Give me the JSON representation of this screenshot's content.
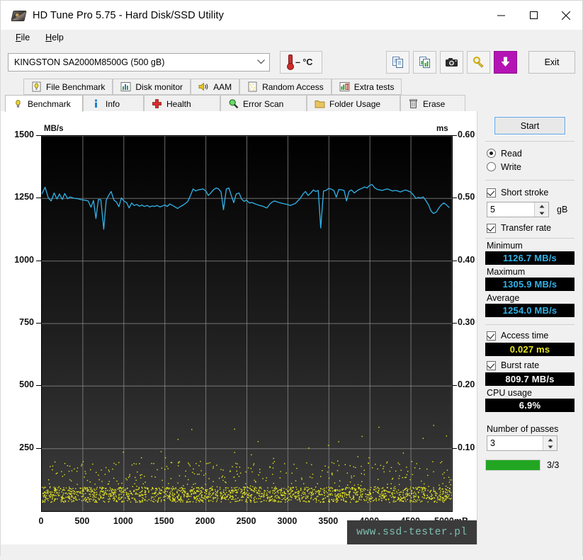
{
  "window": {
    "title": "HD Tune Pro 5.75 - Hard Disk/SSD Utility",
    "icon": "hdd-icon",
    "minimize": "minimize-icon",
    "maximize": "maximize-icon",
    "close": "close-icon"
  },
  "menu": {
    "items": [
      {
        "label": "File",
        "accel": "F"
      },
      {
        "label": "Help",
        "accel": "H"
      }
    ]
  },
  "toolbar": {
    "drive": "KINGSTON SA2000M8500G (500 gB)",
    "temperature": "–  °C",
    "buttons": [
      {
        "name": "copy-icon",
        "label": "Copy"
      },
      {
        "name": "copy-graph-icon",
        "label": "Copy graph"
      },
      {
        "name": "screenshot-icon",
        "label": "Screenshot"
      },
      {
        "name": "options-icon",
        "label": "Options"
      },
      {
        "name": "download-icon",
        "label": "Download"
      }
    ],
    "exit_label": "Exit"
  },
  "tabs": {
    "row1": [
      {
        "label": "File Benchmark",
        "icon": "file-benchmark-icon",
        "active": false
      },
      {
        "label": "Disk monitor",
        "icon": "disk-monitor-icon",
        "active": false
      },
      {
        "label": "AAM",
        "icon": "aam-speaker-icon",
        "active": false
      },
      {
        "label": "Random Access",
        "icon": "random-access-icon",
        "active": false
      },
      {
        "label": "Extra tests",
        "icon": "extra-tests-icon",
        "active": false
      }
    ],
    "row2": [
      {
        "label": "Benchmark",
        "icon": "benchmark-bulb-icon",
        "active": true
      },
      {
        "label": "Info",
        "icon": "info-icon",
        "active": false
      },
      {
        "label": "Health",
        "icon": "health-cross-icon",
        "active": false
      },
      {
        "label": "Error Scan",
        "icon": "error-scan-magnifier-icon",
        "active": false
      },
      {
        "label": "Folder Usage",
        "icon": "folder-usage-icon",
        "active": false
      },
      {
        "label": "Erase",
        "icon": "erase-trash-icon",
        "active": false
      }
    ]
  },
  "controls": {
    "start_label": "Start",
    "mode": {
      "read_label": "Read",
      "write_label": "Write",
      "selected": "Read"
    },
    "short_stroke": {
      "label": "Short stroke",
      "checked": true,
      "value": "5",
      "unit": "gB"
    },
    "transfer_rate": {
      "label": "Transfer rate",
      "checked": true
    },
    "minimum": {
      "label": "Minimum",
      "value": "1126.7 MB/s"
    },
    "maximum": {
      "label": "Maximum",
      "value": "1305.9 MB/s"
    },
    "average": {
      "label": "Average",
      "value": "1254.0 MB/s"
    },
    "access_time": {
      "label": "Access time",
      "checked": true,
      "value": "0.027 ms"
    },
    "burst_rate": {
      "label": "Burst rate",
      "checked": true,
      "value": "809.7 MB/s"
    },
    "cpu_usage": {
      "label": "CPU usage",
      "value": "6.9%"
    },
    "passes": {
      "label": "Number of passes",
      "value": "3",
      "progress_text": "3/3",
      "progress_percent": 100
    }
  },
  "watermark": "www.ssd-tester.pl",
  "chart_data": {
    "type": "line",
    "title": "",
    "ylabel": "MB/s",
    "y2label": "ms",
    "xlabel": "mB",
    "xlim": [
      0,
      5000
    ],
    "xticks": [
      0,
      500,
      1000,
      1500,
      2000,
      2500,
      3000,
      3500,
      4000,
      4500,
      5000
    ],
    "xticklabels": [
      "0",
      "500",
      "1000",
      "1500",
      "2000",
      "2500",
      "3000",
      "3500",
      "4000",
      "4500",
      "5000mB"
    ],
    "ylim": [
      0,
      1500
    ],
    "yticks": [
      250,
      500,
      750,
      1000,
      1250,
      1500
    ],
    "y2lim": [
      0,
      0.6
    ],
    "y2ticks": [
      0.1,
      0.2,
      0.3,
      0.4,
      0.5,
      0.6
    ],
    "grid": true,
    "legend": "none",
    "series": [
      {
        "name": "Transfer rate",
        "color": "#31b3e8",
        "axis": "left",
        "x": [
          0,
          40,
          80,
          115,
          150,
          185,
          215,
          250,
          280,
          315,
          345,
          380,
          410,
          440,
          470,
          500,
          530,
          565,
          600,
          630,
          660,
          690,
          720,
          755,
          785,
          815,
          845,
          880,
          910,
          940,
          970,
          1000,
          1035,
          1065,
          1095,
          1125,
          1160,
          1190,
          1220,
          1250,
          1285,
          1315,
          1345,
          1375,
          1405,
          1440,
          1470,
          1500,
          1530,
          1560,
          1595,
          1625,
          1655,
          1685,
          1720,
          1750,
          1780,
          1810,
          1845,
          1875,
          1905,
          1935,
          1965,
          2000,
          2030,
          2060,
          2090,
          2125,
          2155,
          2185,
          2215,
          2250,
          2280,
          2310,
          2340,
          2370,
          2405,
          2435,
          2465,
          2495,
          2530,
          2560,
          2590,
          2620,
          2655,
          2685,
          2715,
          2745,
          2780,
          2810,
          2840,
          2870,
          2905,
          2935,
          2965,
          2995,
          3030,
          3060,
          3090,
          3120,
          3155,
          3185,
          3215,
          3245,
          3280,
          3310,
          3340,
          3370,
          3400,
          3435,
          3465,
          3495,
          3525,
          3560,
          3590,
          3620,
          3650,
          3685,
          3715,
          3745,
          3775,
          3810,
          3840,
          3870,
          3900,
          3935,
          3965,
          3995,
          4025,
          4060,
          4090,
          4120,
          4150,
          4185,
          4215,
          4245,
          4275,
          4310,
          4340,
          4370,
          4400,
          4435,
          4465,
          4495,
          4525,
          4560,
          4590,
          4620,
          4650,
          4685,
          4715,
          4745,
          4775,
          4810,
          4840,
          4870,
          4900,
          4935,
          4965,
          5000
        ],
        "y": [
          1268,
          1295,
          1252,
          1240,
          1272,
          1248,
          1268,
          1246,
          1270,
          1249,
          1256,
          1252,
          1250,
          1249,
          1246,
          1244,
          1243,
          1240,
          1215,
          1242,
          1170,
          1246,
          1245,
          1127,
          1243,
          1262,
          1278,
          1243,
          1236,
          1217,
          1252,
          1240,
          1233,
          1212,
          1232,
          1222,
          1226,
          1219,
          1224,
          1218,
          1222,
          1216,
          1220,
          1218,
          1222,
          1216,
          1220,
          1224,
          1218,
          1228,
          1222,
          1216,
          1210,
          1217,
          1223,
          1230,
          1238,
          1260,
          1288,
          1280,
          1284,
          1286,
          1288,
          1280,
          1262,
          1272,
          1284,
          1292,
          1288,
          1276,
          1205,
          1288,
          1292,
          1262,
          1233,
          1268,
          1272,
          1248,
          1238,
          1244,
          1232,
          1234,
          1230,
          1226,
          1222,
          1220,
          1216,
          1212,
          1228,
          1236,
          1240,
          1236,
          1233,
          1230,
          1228,
          1226,
          1222,
          1226,
          1230,
          1240,
          1252,
          1268,
          1278,
          1262,
          1272,
          1284,
          1278,
          1282,
          1132,
          1280,
          1282,
          1290,
          1288,
          1282,
          1255,
          1286,
          1285,
          1282,
          1240,
          1278,
          1284,
          1272,
          1280,
          1286,
          1290,
          1296,
          1292,
          1302,
          1306,
          1292,
          1286,
          1284,
          1282,
          1286,
          1288,
          1284,
          1280,
          1282,
          1280,
          1276,
          1280,
          1284,
          1280,
          1276,
          1266,
          1250,
          1254,
          1252,
          1256,
          1240,
          1224,
          1200,
          1190,
          1196,
          1212,
          1224,
          1232,
          1224,
          1214
        ]
      },
      {
        "name": "Access time",
        "color": "#e8e820",
        "axis": "right",
        "style": "scatter",
        "description": "Dense yellow scatter clustered near 0.02-0.05 ms across the full 0-5000 mB range, with sparse outliers up to about 0.13 ms",
        "typical_value": 0.027,
        "outlier_max": 0.14
      }
    ]
  }
}
